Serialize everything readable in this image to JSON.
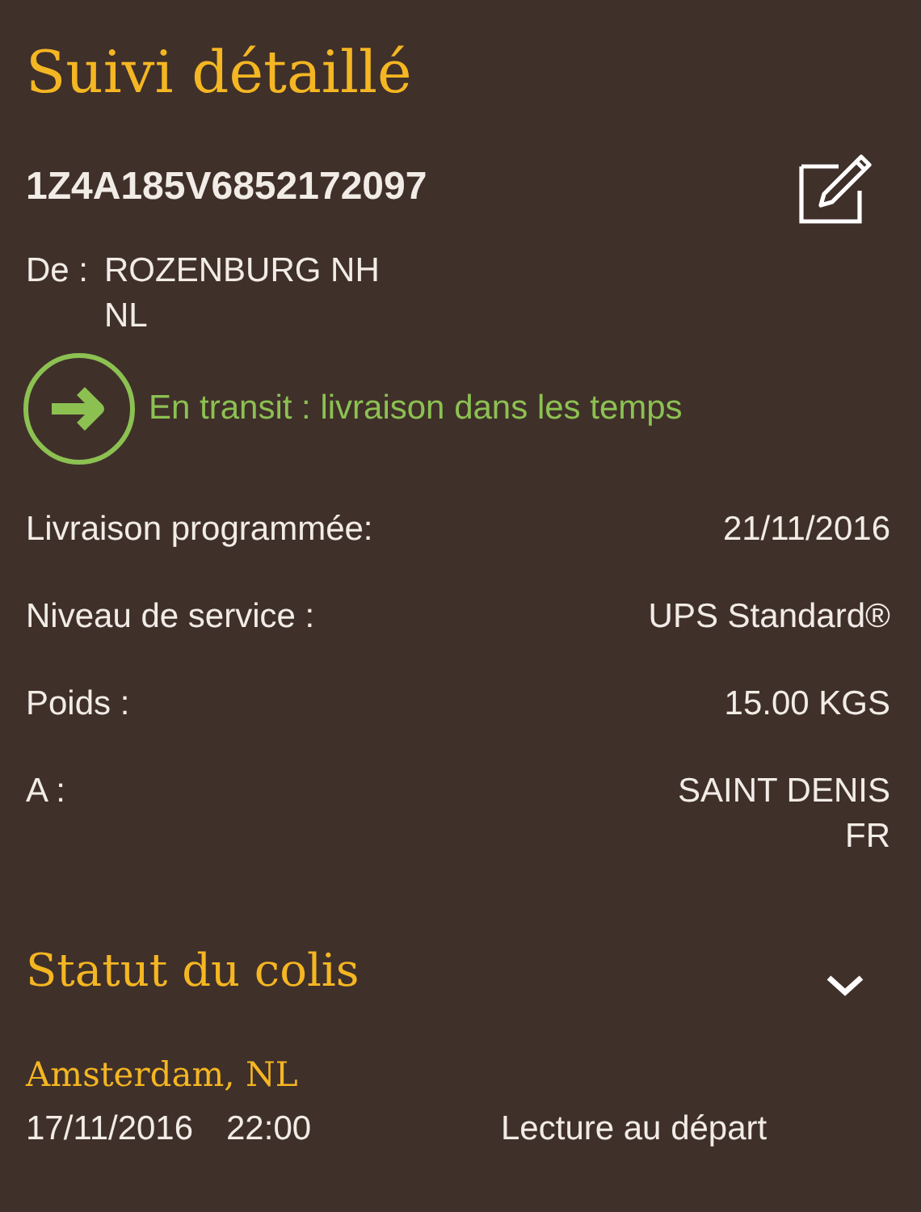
{
  "title": "Suivi détaillé",
  "tracking_number": "1Z4A185V6852172097",
  "origin": {
    "label": "De :",
    "lines": [
      "ROZENBURG NH",
      "NL"
    ]
  },
  "status": {
    "kind": "in_transit",
    "text": "En transit : livraison dans les temps"
  },
  "details": [
    {
      "label": "Livraison programmée:",
      "lines": [
        "21/11/2016"
      ]
    },
    {
      "label": "Niveau de service :",
      "lines": [
        "UPS Standard®"
      ]
    },
    {
      "label": "Poids :",
      "lines": [
        "15.00  KGS"
      ]
    },
    {
      "label": "A :",
      "lines": [
        "SAINT DENIS",
        "FR"
      ]
    }
  ],
  "package_status": {
    "title": "Statut du colis",
    "expanded": false,
    "events": [
      {
        "location": "Amsterdam, NL",
        "date": "17/11/2016",
        "time": "22:00",
        "activity": "Lecture au départ"
      }
    ]
  }
}
